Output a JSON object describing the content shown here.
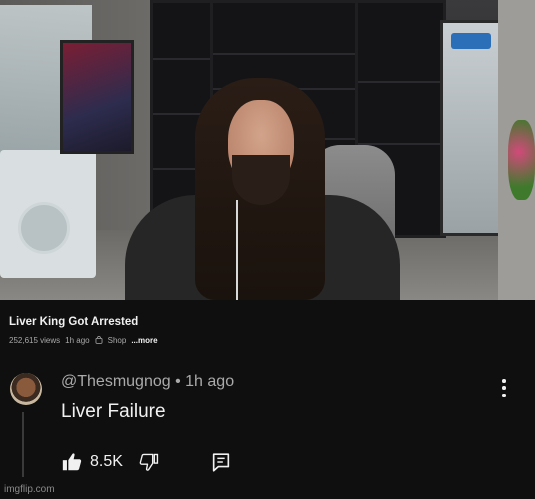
{
  "video": {
    "title": "Liver King Got Arrested",
    "views": "252,615 views",
    "age": "1h ago",
    "shop_label": "Shop",
    "more_label": "...more"
  },
  "comment": {
    "author": "@Thesmugnog",
    "separator": "•",
    "time": "1h ago",
    "text": "Liver Failure",
    "likes": "8.5K"
  },
  "icons": {
    "like": "thumbs-up-icon",
    "dislike": "thumbs-down-icon",
    "reply": "reply-comment-icon",
    "menu": "more-vertical-icon",
    "shop": "shopping-bag-icon"
  },
  "colors": {
    "background": "#0f0f0f",
    "primary_text": "#f1f1f1",
    "secondary_text": "#aaaaaa"
  },
  "watermark": "imgflip.com"
}
